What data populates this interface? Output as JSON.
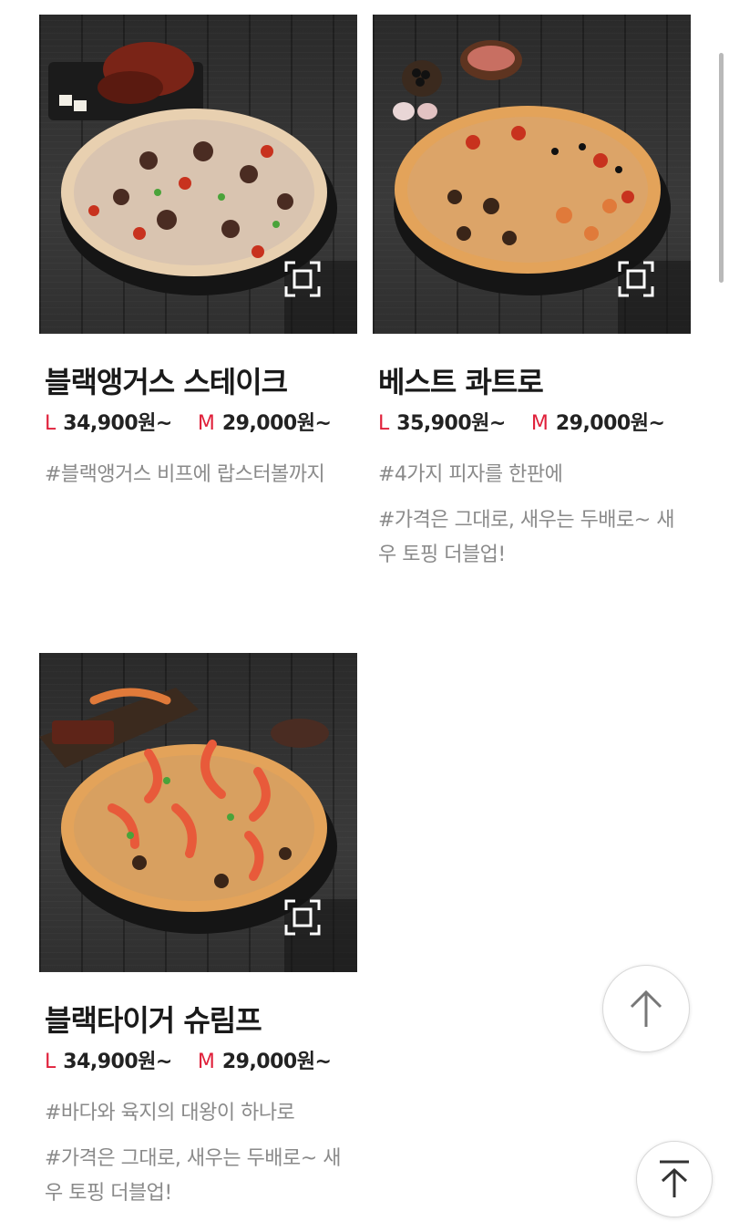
{
  "products": [
    {
      "name": "블랙앵거스 스테이크",
      "price_l_label": "L",
      "price_l": "34,900원~",
      "price_m_label": "M",
      "price_m": "29,000원~",
      "desc1": "#블랙앵거스 비프에 랍스터볼까지",
      "desc2": ""
    },
    {
      "name": "베스트 콰트로",
      "price_l_label": "L",
      "price_l": "35,900원~",
      "price_m_label": "M",
      "price_m": "29,000원~",
      "desc1": "#4가지 피자를 한판에",
      "desc2": "#가격은 그대로, 새우는 두배로~ 새우 토핑 더블업!"
    },
    {
      "name": "블랙타이거 슈림프",
      "price_l_label": "L",
      "price_l": "34,900원~",
      "price_m_label": "M",
      "price_m": "29,000원~",
      "desc1": "#바다와 육지의 대왕이 하나로",
      "desc2": "#가격은 그대로, 새우는 두배로~ 새우 토핑 더블업!"
    }
  ],
  "icons": {
    "zoom": "expand-icon",
    "scroll_up": "arrow-up-icon",
    "scroll_top": "scroll-to-top-icon"
  },
  "colors": {
    "accent": "#e0203a",
    "name": "#1a1a1a",
    "desc": "#8a8a8a"
  }
}
